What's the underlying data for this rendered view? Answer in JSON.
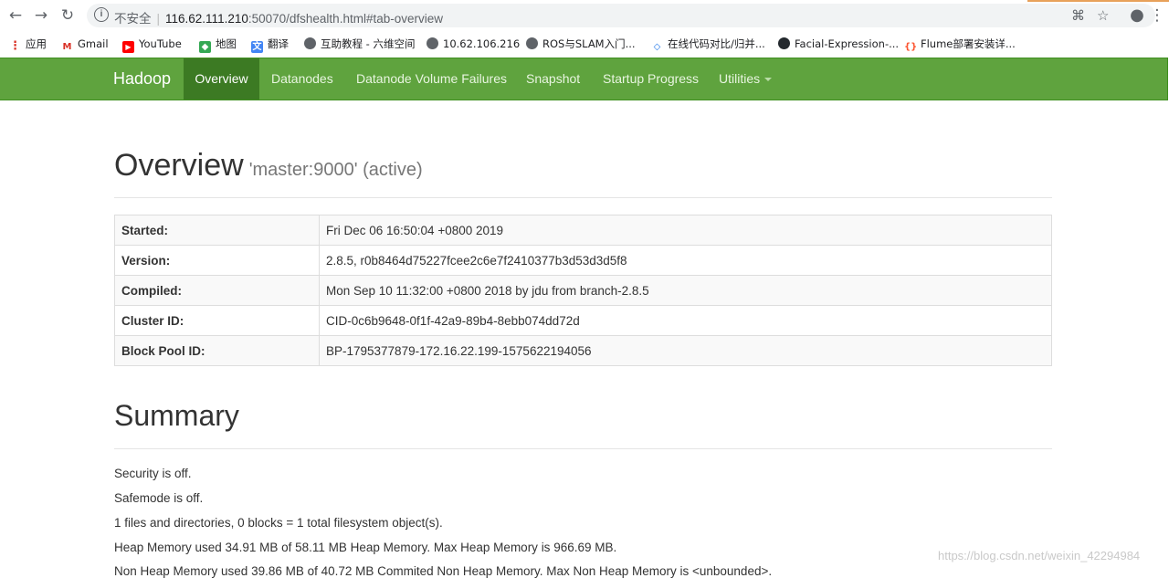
{
  "browser": {
    "security_label": "不安全",
    "url_host": "116.62.111.210",
    "url_rest": ":50070/dfshealth.html#tab-overview",
    "bookmarks": [
      {
        "label": "应用",
        "icon": "apps-grid-icon",
        "color": "#d93025"
      },
      {
        "label": "Gmail",
        "icon": "gmail-icon",
        "color": "#d93025"
      },
      {
        "label": "YouTube",
        "icon": "youtube-icon",
        "color": "#ff0000"
      },
      {
        "label": "地图",
        "icon": "maps-icon",
        "color": "#34a853"
      },
      {
        "label": "翻译",
        "icon": "translate-icon",
        "color": "#4285f4"
      },
      {
        "label": "互助教程 - 六维空间",
        "icon": "globe-icon",
        "color": "#5f6368"
      },
      {
        "label": "10.62.106.216",
        "icon": "globe-icon",
        "color": "#5f6368"
      },
      {
        "label": "ROS与SLAM入门...",
        "icon": "globe-icon",
        "color": "#5f6368"
      },
      {
        "label": "在线代码对比/归并...",
        "icon": "diff-icon",
        "color": "#1a73e8"
      },
      {
        "label": "Facial-Expression-...",
        "icon": "github-icon",
        "color": "#24292e"
      },
      {
        "label": "Flume部署安装详...",
        "icon": "csdn-icon",
        "color": "#fc5531"
      }
    ]
  },
  "navbar": {
    "brand": "Hadoop",
    "items": [
      "Overview",
      "Datanodes",
      "Datanode Volume Failures",
      "Snapshot",
      "Startup Progress",
      "Utilities"
    ]
  },
  "overview": {
    "title": "Overview",
    "subtitle": "'master:9000' (active)",
    "rows": [
      {
        "key": "Started:",
        "value": "Fri Dec 06 16:50:04 +0800 2019"
      },
      {
        "key": "Version:",
        "value": "2.8.5, r0b8464d75227fcee2c6e7f2410377b3d53d3d5f8"
      },
      {
        "key": "Compiled:",
        "value": "Mon Sep 10 11:32:00 +0800 2018 by jdu from branch-2.8.5"
      },
      {
        "key": "Cluster ID:",
        "value": "CID-0c6b9648-0f1f-42a9-89b4-8ebb074dd72d"
      },
      {
        "key": "Block Pool ID:",
        "value": "BP-1795377879-172.16.22.199-1575622194056"
      }
    ]
  },
  "summary": {
    "title": "Summary",
    "lines": [
      "Security is off.",
      "Safemode is off.",
      "1 files and directories, 0 blocks = 1 total filesystem object(s).",
      "Heap Memory used 34.91 MB of 58.11 MB Heap Memory. Max Heap Memory is 966.69 MB.",
      "Non Heap Memory used 39.86 MB of 40.72 MB Commited Non Heap Memory. Max Non Heap Memory is <unbounded>."
    ]
  },
  "watermark": "https://blog.csdn.net/weixin_42294984"
}
